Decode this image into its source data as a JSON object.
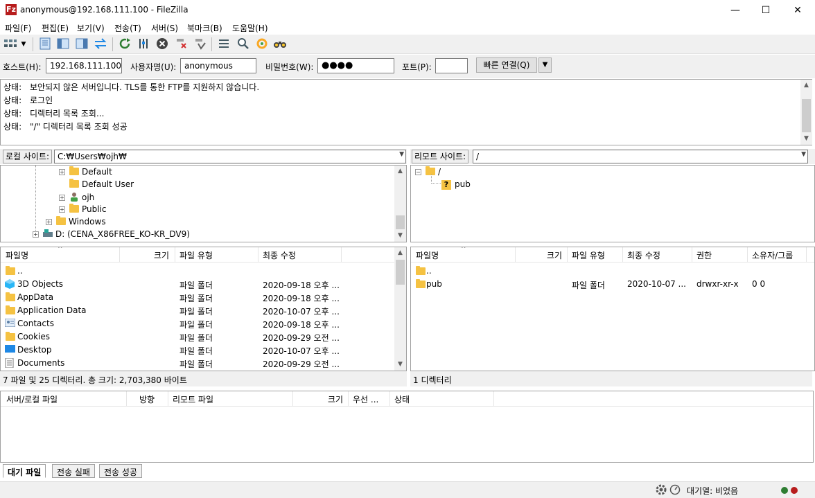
{
  "window": {
    "title": "anonymous@192.168.111.100 - FileZilla",
    "app_icon": "Fz",
    "controls": {
      "minimize": "—",
      "maximize": "☐",
      "close": "✕"
    }
  },
  "menu": [
    "파일(F)",
    "편집(E)",
    "보기(V)",
    "전송(T)",
    "서버(S)",
    "북마크(B)",
    "도움말(H)"
  ],
  "toolbar": {
    "icons": [
      "site-manager",
      "dropdown",
      "toggle-log",
      "toggle-local-tree",
      "toggle-remote-tree",
      "toggle-queue",
      "refresh",
      "process-queue",
      "cancel",
      "disconnect",
      "reconnect",
      "directory-listing-filters",
      "search",
      "sync-browse",
      "compare"
    ]
  },
  "quickconnect": {
    "host_label": "호스트(H):",
    "host_value": "192.168.111.100",
    "user_label": "사용자명(U):",
    "user_value": "anonymous",
    "pass_label": "비밀번호(W):",
    "pass_value": "●●●●",
    "port_label": "포트(P):",
    "port_value": "",
    "connect_label": "빠른 연결(Q)",
    "dropdown": "▼"
  },
  "log": [
    {
      "label": "상태:",
      "text": "보안되지 않은 서버입니다. TLS를 통한 FTP를 지원하지 않습니다."
    },
    {
      "label": "상태:",
      "text": "로그인"
    },
    {
      "label": "상태:",
      "text": "디렉터리 목록 조회..."
    },
    {
      "label": "상태:",
      "text": "\"/\" 디렉터리 목록 조회 성공"
    }
  ],
  "local": {
    "site_label": "로컬 사이트:",
    "path": "C:₩Users₩ojh₩",
    "tree": [
      "Default",
      "Default User",
      "ojh",
      "Public",
      "Windows",
      "D: (CENA_X86FREE_KO-KR_DV9)"
    ],
    "columns": [
      "파일명",
      "크기",
      "파일 유형",
      "최종 수정"
    ],
    "files": [
      {
        "name": "..",
        "type": "",
        "modified": ""
      },
      {
        "name": "3D Objects",
        "type": "파일 폴더",
        "modified": "2020-09-18 오후 ..."
      },
      {
        "name": "AppData",
        "type": "파일 폴더",
        "modified": "2020-09-18 오후 ..."
      },
      {
        "name": "Application Data",
        "type": "파일 폴더",
        "modified": "2020-10-07 오후 ..."
      },
      {
        "name": "Contacts",
        "type": "파일 폴더",
        "modified": "2020-09-18 오후 ..."
      },
      {
        "name": "Cookies",
        "type": "파일 폴더",
        "modified": "2020-09-29 오전 ..."
      },
      {
        "name": "Desktop",
        "type": "파일 폴더",
        "modified": "2020-10-07 오후 ..."
      },
      {
        "name": "Documents",
        "type": "파일 폴더",
        "modified": "2020-09-29 오전 ..."
      }
    ],
    "status": "7 파일 및 25 디렉터리. 총 크기: 2,703,380 바이트"
  },
  "remote": {
    "site_label": "리모트 사이트:",
    "path": "/",
    "tree": [
      "/",
      "pub"
    ],
    "columns": [
      "파일명",
      "크기",
      "파일 유형",
      "최종 수정",
      "권한",
      "소유자/그룹"
    ],
    "files": [
      {
        "name": "..",
        "type": "",
        "modified": "",
        "perms": "",
        "owner": ""
      },
      {
        "name": "pub",
        "type": "파일 폴더",
        "modified": "2020-10-07 ...",
        "perms": "drwxr-xr-x",
        "owner": "0 0"
      }
    ],
    "status": "1 디렉터리"
  },
  "queue": {
    "columns": [
      "서버/로컬 파일",
      "방향",
      "리모트 파일",
      "크기",
      "우선 ...",
      "상태"
    ],
    "tabs": [
      "대기 파일",
      "전송 실패",
      "전송 성공"
    ]
  },
  "statusbar": {
    "queue_text": "대기열: 비었음"
  },
  "colors": {
    "chrome": "#f0f0f0",
    "folder": "#f5c242",
    "sync": "#1e88e5",
    "cancel": "#424242"
  }
}
